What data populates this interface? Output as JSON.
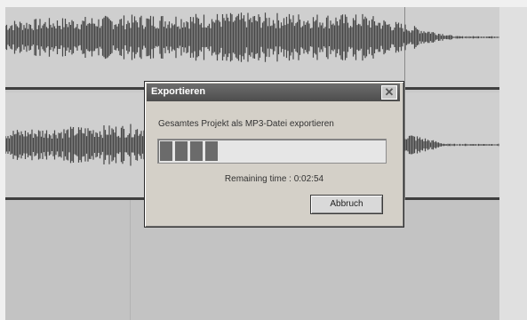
{
  "dialog": {
    "title": "Exportieren",
    "message": "Gesamtes Projekt als MP3-Datei exportieren",
    "remaining_time": "Remaining time : 0:02:54",
    "abort_label": "Abbruch",
    "close_symbol": "✕",
    "progress_fraction": 0.27
  },
  "icons": {
    "close": "close-icon"
  },
  "colors": {
    "waveform": "#474747",
    "title_bar": "#5a5a5a",
    "progress_fill": "#6b6b6b"
  }
}
